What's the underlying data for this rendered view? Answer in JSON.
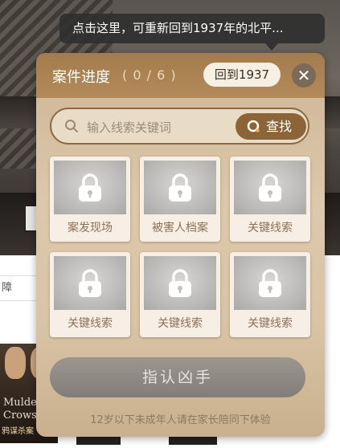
{
  "tooltip": {
    "text": "点击这里，可重新回到1937年的北平..."
  },
  "panel": {
    "title": "案件进度",
    "progress": "( 0 / 6 )",
    "return_label": "回到1937",
    "close_symbol": "✕"
  },
  "search": {
    "placeholder": "输入线索关键词",
    "button_label": "查找"
  },
  "cards": [
    {
      "label": "案发现场",
      "locked": true
    },
    {
      "label": "被害人档案",
      "locked": true
    },
    {
      "label": "关键线索",
      "locked": true
    },
    {
      "label": "关键线索",
      "locked": true
    },
    {
      "label": "关键线索",
      "locked": true
    },
    {
      "label": "关键线索",
      "locked": true
    }
  ],
  "confirm": {
    "label": "指认凶手"
  },
  "notice": "12岁以下未成年人请在家长陪同下体验",
  "background": {
    "side_text": "障",
    "poster": {
      "line1": "Mulder",
      "line2": "Crows",
      "line3": "鸦谋杀案"
    }
  },
  "colors": {
    "accent": "#8b6537",
    "header": "#a47b4c",
    "panel": "#dcc8aa"
  }
}
